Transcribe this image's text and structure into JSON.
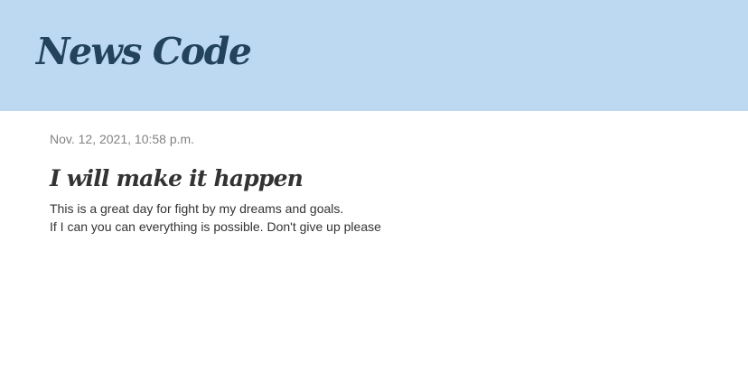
{
  "header": {
    "site_title": "News Code"
  },
  "post": {
    "date": "Nov. 12, 2021, 10:58 p.m.",
    "title": "I will make it happen",
    "body_lines": [
      "This is a great day for fight by my dreams and goals.",
      "If I can you can everything is possible. Don't give up please"
    ]
  },
  "colors": {
    "header_background": "#bcd9f1",
    "site_title": "#23435c",
    "date_text": "#828282",
    "body_text": "#333333"
  }
}
